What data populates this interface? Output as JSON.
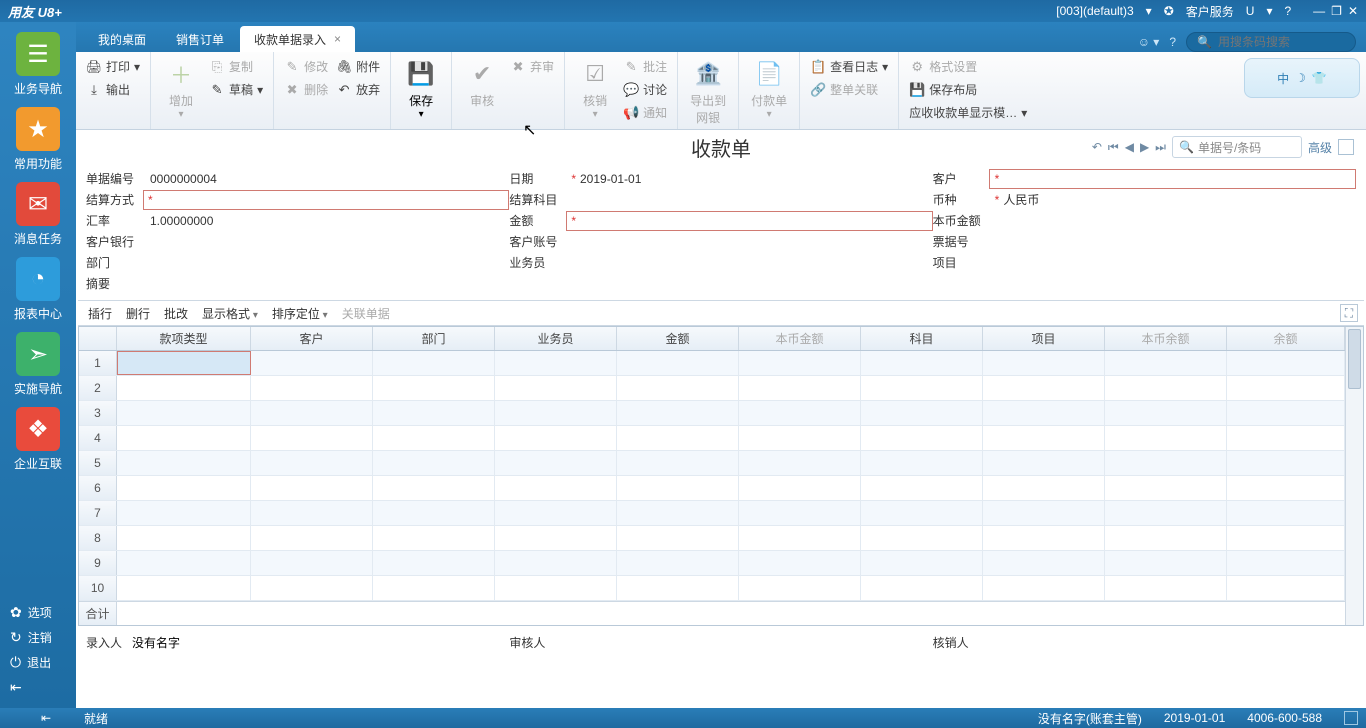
{
  "titlebar": {
    "brand": "用友 U8+",
    "account": "[003](default)3",
    "service": "客户服务",
    "u": "U"
  },
  "sidebar": {
    "items": [
      {
        "label": "业务导航",
        "glyph": "☰",
        "cls": "ico-g"
      },
      {
        "label": "常用功能",
        "glyph": "★",
        "cls": "ico-o"
      },
      {
        "label": "消息任务",
        "glyph": "✉",
        "cls": "ico-r"
      },
      {
        "label": "报表中心",
        "glyph": "◔",
        "cls": "ico-b"
      },
      {
        "label": "实施导航",
        "glyph": "➣",
        "cls": "ico-gr"
      },
      {
        "label": "企业互联",
        "glyph": "❖",
        "cls": "ico-rd"
      }
    ],
    "bottom": [
      {
        "label": "选项",
        "glyph": "✿"
      },
      {
        "label": "注销",
        "glyph": "↻"
      },
      {
        "label": "退出",
        "glyph": "⏻"
      }
    ]
  },
  "tabs": [
    {
      "label": "我的桌面",
      "active": false
    },
    {
      "label": "销售订单",
      "active": false
    },
    {
      "label": "收款单据录入",
      "active": true
    }
  ],
  "tabsearch": {
    "placeholder": "用搜条码搜索"
  },
  "ribbon": {
    "g1": [
      {
        "l": "打印",
        "g": "🖨"
      },
      {
        "l": "输出",
        "g": "⤓"
      }
    ],
    "g2big": {
      "l": "增加",
      "g": "＋"
    },
    "g2": [
      {
        "l": "复制",
        "g": "⎘"
      },
      {
        "l": "草稿",
        "g": "✎"
      }
    ],
    "g3": [
      {
        "l": "修改",
        "g": "✎"
      },
      {
        "l": "删除",
        "g": "✖"
      }
    ],
    "g3r": [
      {
        "l": "附件",
        "g": "🖇"
      },
      {
        "l": "放弃",
        "g": "↶"
      }
    ],
    "save": {
      "l": "保存",
      "g": "💾"
    },
    "g5": [
      {
        "l": "审核",
        "g": "✔"
      },
      {
        "l": "弃审",
        "g": "✖"
      }
    ],
    "g6big": {
      "l": "核销",
      "g": "☑"
    },
    "g6": [
      {
        "l": "批注",
        "g": "✎"
      },
      {
        "l": "讨论",
        "g": "💬"
      },
      {
        "l": "通知",
        "g": "📢"
      }
    ],
    "exportbank": {
      "l": "导出到网银",
      "g": "🏦"
    },
    "pay": {
      "l": "付款单",
      "g": "📄"
    },
    "g9": [
      {
        "l": "查看日志",
        "g": "📋"
      },
      {
        "l": "整单关联",
        "g": "🔗"
      }
    ],
    "g10": [
      {
        "l": "格式设置",
        "g": "⚙"
      },
      {
        "l": "保存布局",
        "g": "💾"
      },
      {
        "l": "应收收款单显示模…",
        "g": ""
      }
    ]
  },
  "doc": {
    "title": "收款单",
    "nav_placeholder": "单据号/条码",
    "adv": "高级"
  },
  "form": {
    "r1": [
      {
        "l": "单据编号",
        "v": "0000000004"
      },
      {
        "l": "日期",
        "v": "2019-01-01",
        "req": false,
        "ast": true
      },
      {
        "l": "客户",
        "v": "",
        "req": true,
        "ast": true
      }
    ],
    "r2": [
      {
        "l": "结算方式",
        "v": "",
        "req": true,
        "ast": true
      },
      {
        "l": "结算科目",
        "v": ""
      },
      {
        "l": "币种",
        "v": "人民币",
        "ast": true
      }
    ],
    "r3": [
      {
        "l": "汇率",
        "v": "1.00000000"
      },
      {
        "l": "金额",
        "v": "",
        "req": true,
        "ast": true
      },
      {
        "l": "本币金额",
        "v": ""
      }
    ],
    "r4": [
      {
        "l": "客户银行",
        "v": ""
      },
      {
        "l": "客户账号",
        "v": ""
      },
      {
        "l": "票据号",
        "v": ""
      }
    ],
    "r5": [
      {
        "l": "部门",
        "v": ""
      },
      {
        "l": "业务员",
        "v": ""
      },
      {
        "l": "项目",
        "v": ""
      }
    ],
    "r6": [
      {
        "l": "摘要",
        "v": ""
      }
    ]
  },
  "mtb": {
    "items": [
      "插行",
      "删行",
      "批改"
    ],
    "display": "显示格式",
    "sort": "排序定位",
    "link": "关联单据"
  },
  "grid": {
    "cols": [
      "款项类型",
      "客户",
      "部门",
      "业务员",
      "金额",
      "本币金额",
      "科目",
      "项目",
      "本币余额",
      "余额"
    ],
    "disabled_cols": [
      5,
      8,
      9
    ],
    "rows": 10,
    "total": "合计"
  },
  "docfoot": {
    "enter": "录入人",
    "enter_v": "没有名字",
    "audit": "审核人",
    "cancel": "核销人"
  },
  "status": {
    "ready": "就绪",
    "user": "没有名字(账套主管)",
    "date": "2019-01-01",
    "tel": "4006-600-588"
  },
  "chart_data": null
}
